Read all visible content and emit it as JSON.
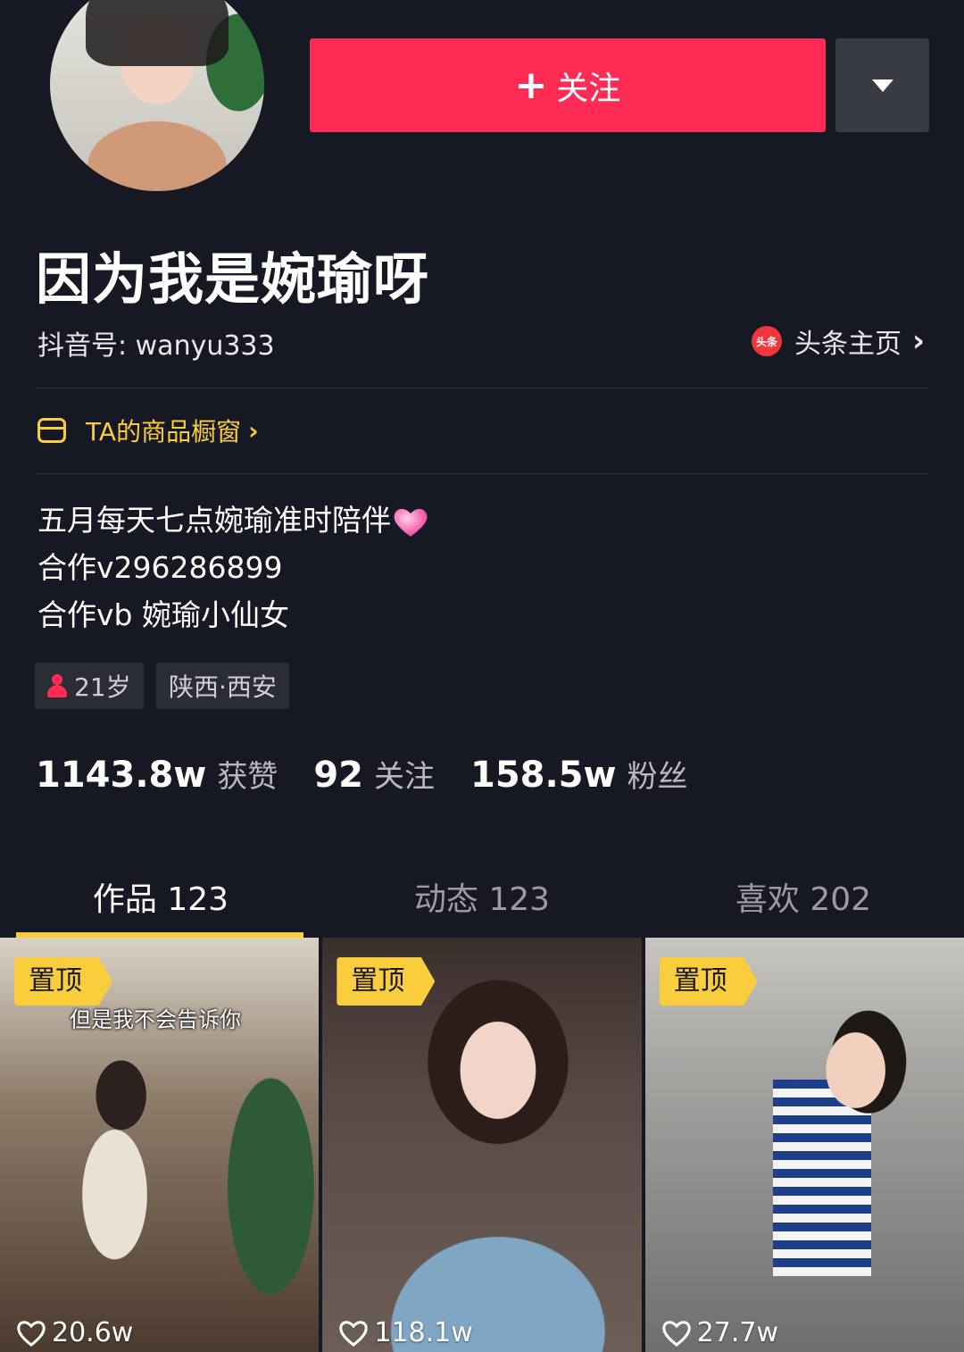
{
  "header": {
    "follow_label": "关注",
    "username": "因为我是婉瑜呀",
    "douyin_id": "抖音号: wanyu333",
    "toutiao_label": "头条主页",
    "toutiao_logo_text": "头条"
  },
  "shop": {
    "label": "TA的商品橱窗"
  },
  "bio": [
    "五月每天七点婉瑜准时陪伴",
    "合作v296286899",
    "合作vb 婉瑜小仙女"
  ],
  "tags": {
    "age": "21岁",
    "location": "陕西·西安"
  },
  "stats": [
    {
      "num": "1143.8w",
      "label": "获赞"
    },
    {
      "num": "92",
      "label": "关注"
    },
    {
      "num": "158.5w",
      "label": "粉丝"
    }
  ],
  "tabs": [
    {
      "label": "作品 123",
      "active": true
    },
    {
      "label": "动态 123",
      "active": false
    },
    {
      "label": "喜欢 202",
      "active": false
    }
  ],
  "videos": [
    {
      "pin": "置顶",
      "likes": "20.6w",
      "caption": "但是我不会告诉你"
    },
    {
      "pin": "置顶",
      "likes": "118.1w"
    },
    {
      "pin": "置顶",
      "likes": "27.7w"
    }
  ],
  "colors": {
    "brand": "#fe2c55",
    "accent": "#facd3c",
    "background": "#161823"
  }
}
